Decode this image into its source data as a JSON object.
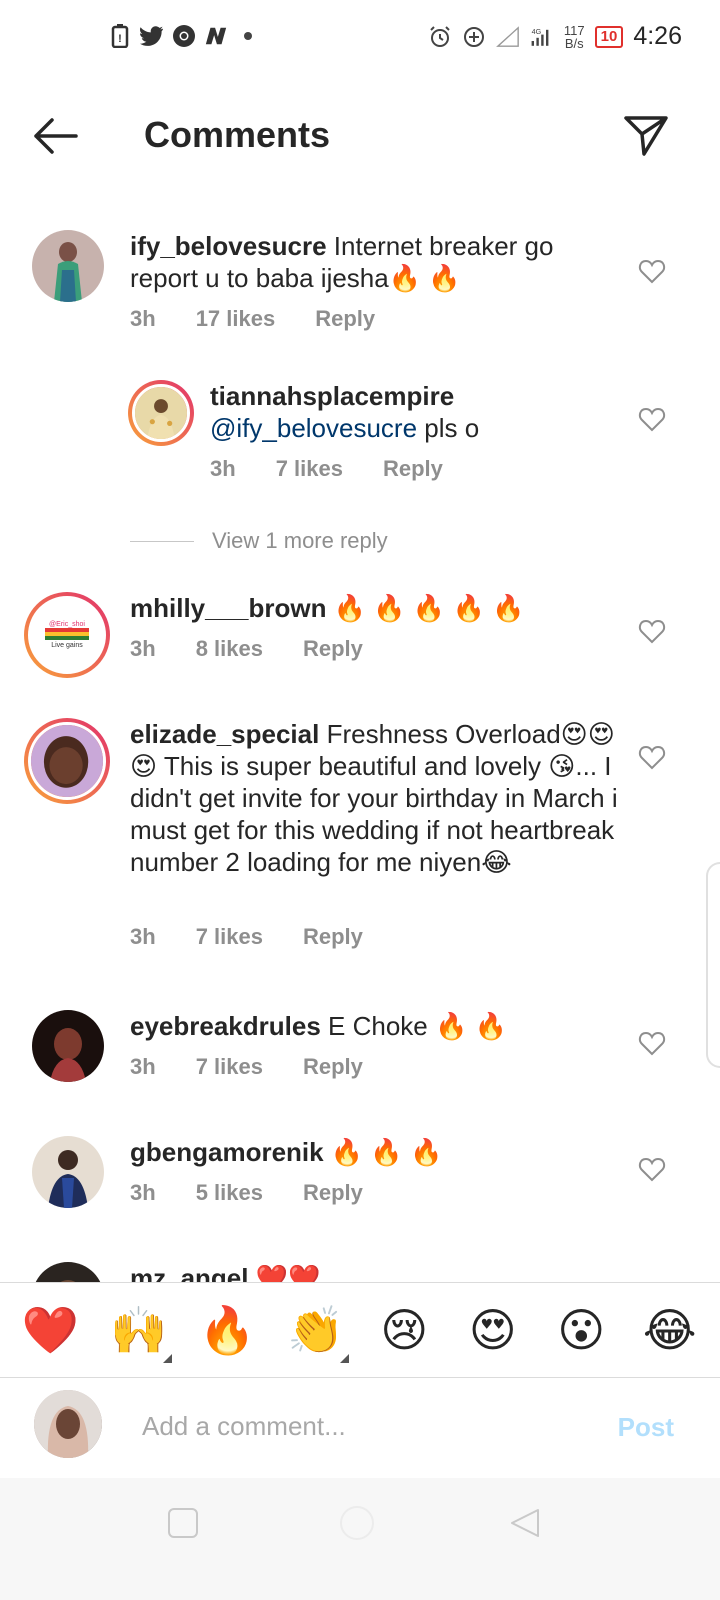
{
  "status_bar": {
    "time": "4:26",
    "net_speed": "117",
    "net_unit": "B/s",
    "battery": "10",
    "network_type": "4G",
    "left_icons": [
      "battery-saver-icon",
      "twitter-icon",
      "chrome-icon",
      "news-icon",
      "dot-icon"
    ],
    "right_icons": [
      "alarm-icon",
      "add-circle-icon",
      "signal-empty-icon",
      "signal-icon"
    ]
  },
  "header": {
    "title": "Comments",
    "back_icon": "back-arrow-icon",
    "share_icon": "paper-plane-icon"
  },
  "comments": [
    {
      "username": "ify_belovesucre",
      "text": " Internet breaker go report u to baba ijesha🔥 🔥",
      "time": "3h",
      "likes": "17 likes",
      "reply": "Reply"
    },
    {
      "username": "tiannahsplacempire",
      "mention": "@ify_belovesucre",
      "text": " pls o",
      "time": "3h",
      "likes": "7 likes",
      "reply": "Reply"
    },
    {
      "username": "mhilly___brown",
      "text": " 🔥 🔥 🔥 🔥 🔥",
      "time": "3h",
      "likes": "8 likes",
      "reply": "Reply",
      "avatar_line1": "@Eric_shoi",
      "avatar_line2": "Live gains"
    },
    {
      "username": "elizade_special",
      "text": " Freshness Overload😍😍😍 This is super beautiful and lovely 😘... I didn't get invite for your birthday in March i must get for this wedding if not heartbreak number 2 loading for me niyen😂",
      "time": "3h",
      "likes": "7 likes",
      "reply": "Reply"
    },
    {
      "username": "eyebreakdrules",
      "text": " E Choke 🔥 🔥",
      "time": "3h",
      "likes": "7 likes",
      "reply": "Reply"
    },
    {
      "username": "gbengamorenik",
      "text": " 🔥 🔥 🔥",
      "time": "3h",
      "likes": "5 likes",
      "reply": "Reply"
    },
    {
      "username": "mz_angel",
      "text": " ❤️❤️"
    }
  ],
  "view_more_replies": "View 1 more reply",
  "quick_emojis": [
    "❤️",
    "🙌",
    "🔥",
    "👏",
    "😢",
    "😍",
    "😮",
    "😂"
  ],
  "add_comment": {
    "placeholder": "Add a comment...",
    "post_label": "Post"
  },
  "colors": {
    "username": "#262626",
    "meta": "#8e8e8e",
    "mention": "#00376b",
    "post_disabled": "#b2dffc",
    "battery_low": "#e0302c"
  }
}
